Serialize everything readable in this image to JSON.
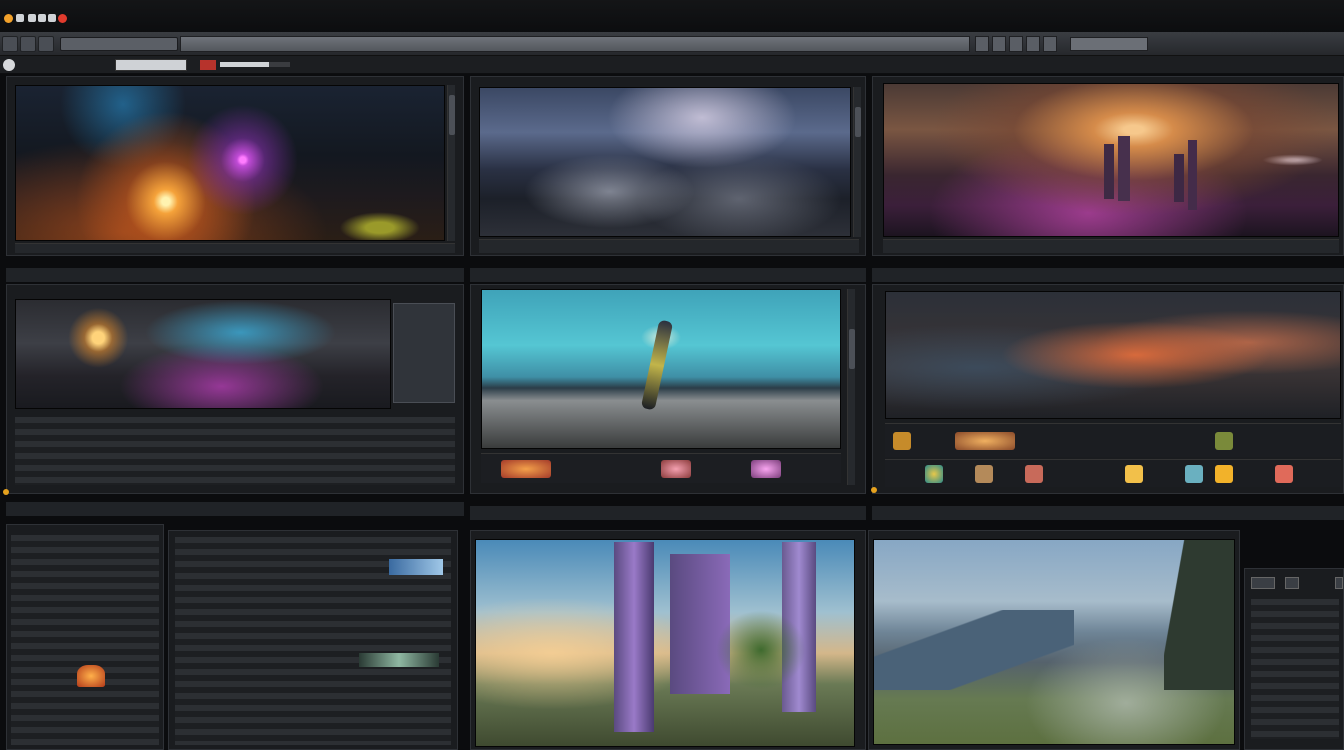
{
  "window": {
    "title_bar_colors": [
      "#f2a12b",
      "#e13b2d"
    ]
  },
  "menubar": {
    "field_text": "",
    "icons": [
      "menu-icon",
      "search-icon",
      "grid-icon",
      "list-icon",
      "lock-icon"
    ]
  },
  "toolbar": {
    "progress": 0.7,
    "left_text": "",
    "center_text": "",
    "right_text": ""
  },
  "panels": {
    "top_left": {
      "caption": ""
    },
    "top_center": {
      "caption": ""
    },
    "top_right": {
      "caption": ""
    },
    "mid_left": {
      "caption": ""
    },
    "mid_center": {
      "caption": ""
    },
    "mid_right": {
      "caption": ""
    },
    "bottom_left": {
      "caption": ""
    },
    "bottom_center": {
      "caption": ""
    },
    "bottom_right": {
      "caption": ""
    }
  },
  "colors": {
    "accent_orange": "#e6a21e",
    "accent_red": "#b7332c",
    "panel_bg": "#1a1c1f"
  }
}
